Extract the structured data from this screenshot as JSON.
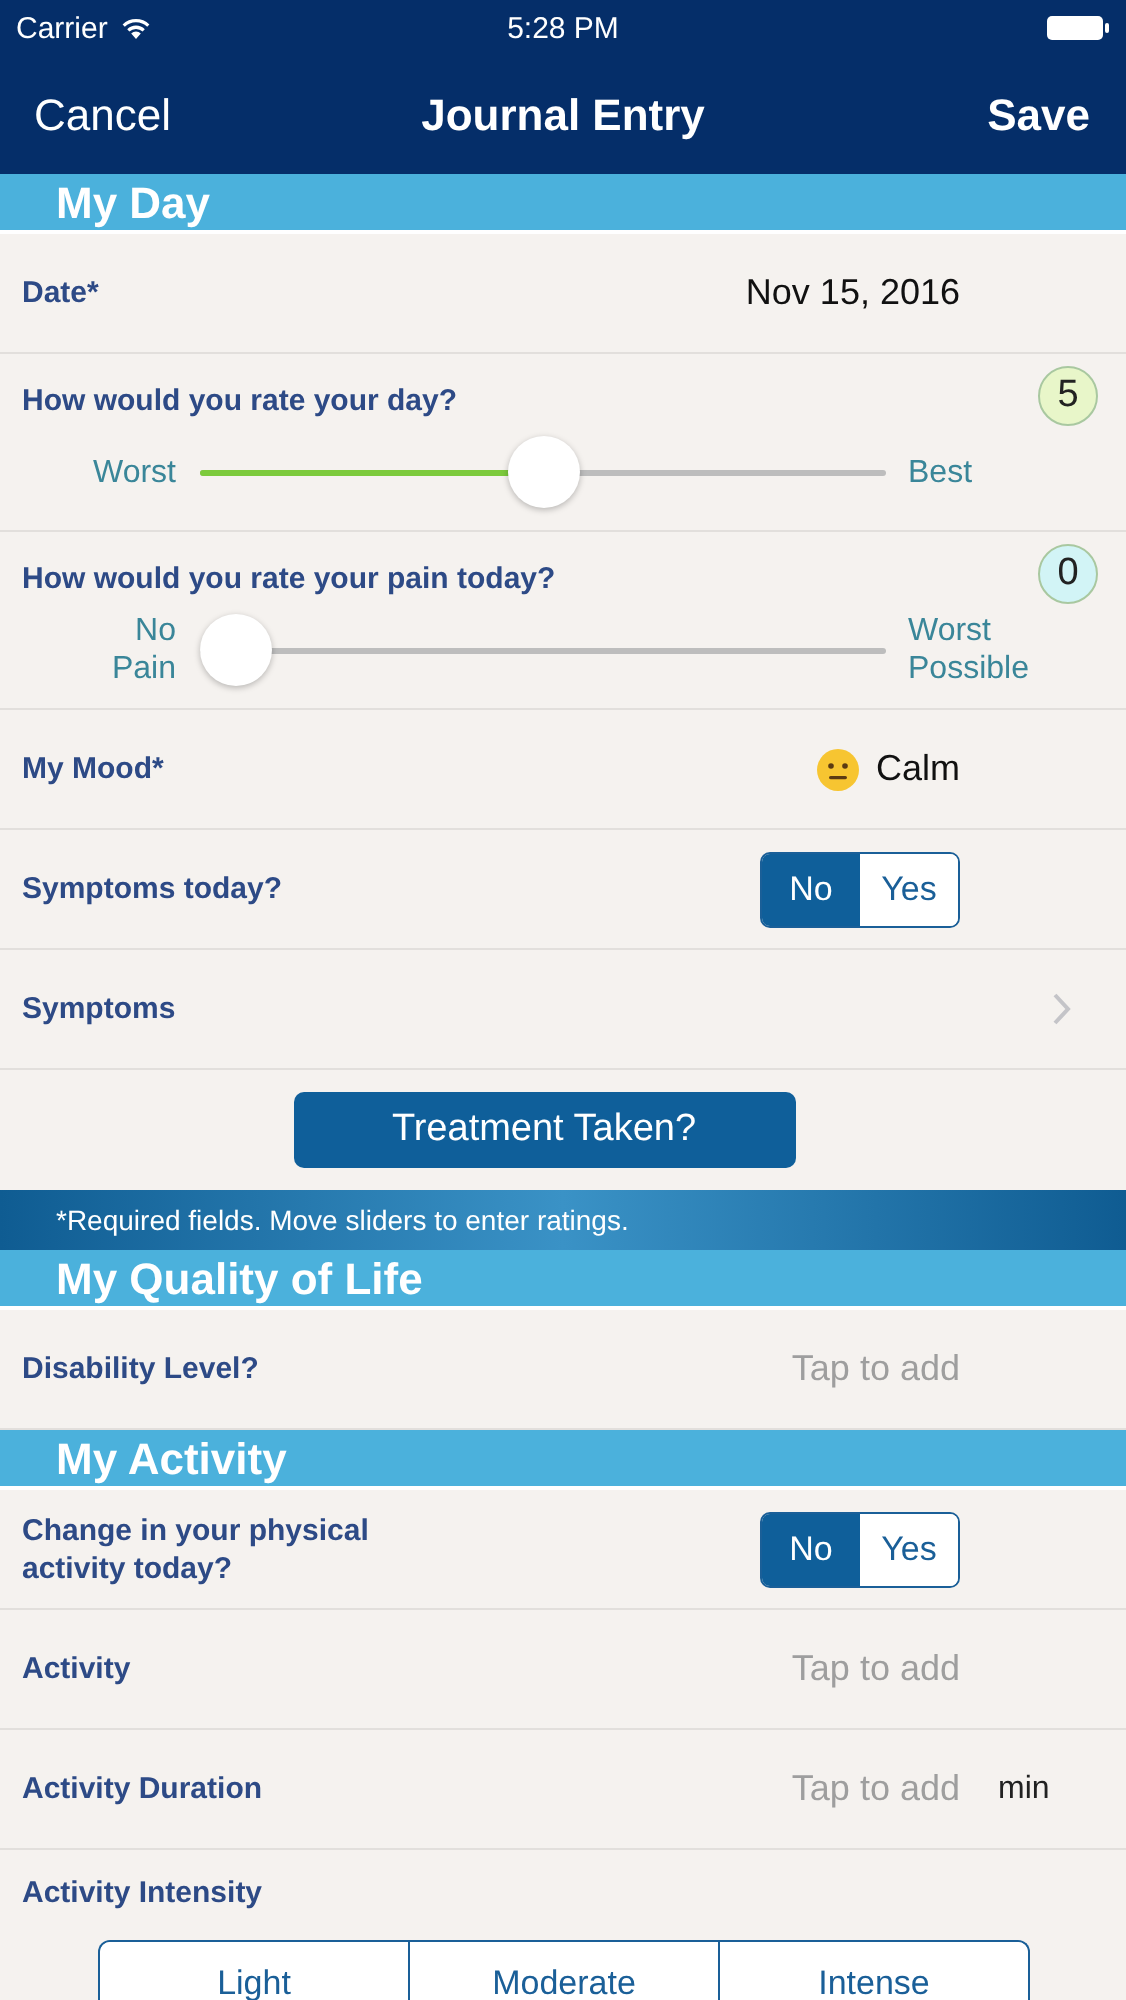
{
  "status_bar": {
    "carrier": "Carrier",
    "time": "5:28 PM"
  },
  "nav": {
    "cancel": "Cancel",
    "title": "Journal Entry",
    "save": "Save"
  },
  "sections": [
    {
      "title": "My Day",
      "rows": [
        {
          "kind": "value",
          "label": "Date*",
          "value": "Nov 15, 2016"
        },
        {
          "kind": "slider",
          "label": "How would you rate your day?",
          "score": "5",
          "color": "#e8f6c9",
          "min_label": "Worst",
          "max_label": "Best",
          "level": 0.5
        },
        {
          "kind": "slider",
          "label": "How would you rate your pain today?",
          "score": "0",
          "color": "#d2f4f6",
          "min_label": "No Pain",
          "max_label": "Worst Possible",
          "level": 0
        },
        {
          "kind": "mood",
          "label": "My Mood*",
          "value": "Calm"
        },
        {
          "kind": "toggle",
          "label": "Symptoms today?",
          "options": [
            {
              "label": "No",
              "selected": true
            },
            {
              "label": "Yes",
              "selected": false
            }
          ]
        },
        {
          "kind": "link",
          "label": "Symptoms"
        },
        {
          "kind": "button",
          "label": "Treatment Taken?"
        },
        {
          "kind": "note",
          "text": "*Required fields. Move sliders to enter ratings."
        }
      ]
    },
    {
      "title": "My Quality of Life",
      "rows": [
        {
          "kind": "input",
          "label": "Disability Level?",
          "placeholder": "Tap to add"
        }
      ]
    },
    {
      "title": "My Activity",
      "rows": [
        {
          "kind": "toggle",
          "label": "Change in your physical activity today?",
          "options": [
            {
              "label": "No",
              "selected": true
            },
            {
              "label": "Yes",
              "selected": false
            }
          ]
        },
        {
          "kind": "input",
          "label": "Activity",
          "placeholder": "Tap to add"
        },
        {
          "kind": "input",
          "label": "Activity Duration",
          "placeholder": "Tap to add",
          "unit": "min"
        },
        {
          "kind": "segmented",
          "label": "Activity Intensity",
          "options": [
            {
              "label": "Light",
              "selected": false
            },
            {
              "label": "Moderate",
              "selected": false
            },
            {
              "label": "Intense",
              "selected": false
            }
          ]
        }
      ]
    }
  ]
}
